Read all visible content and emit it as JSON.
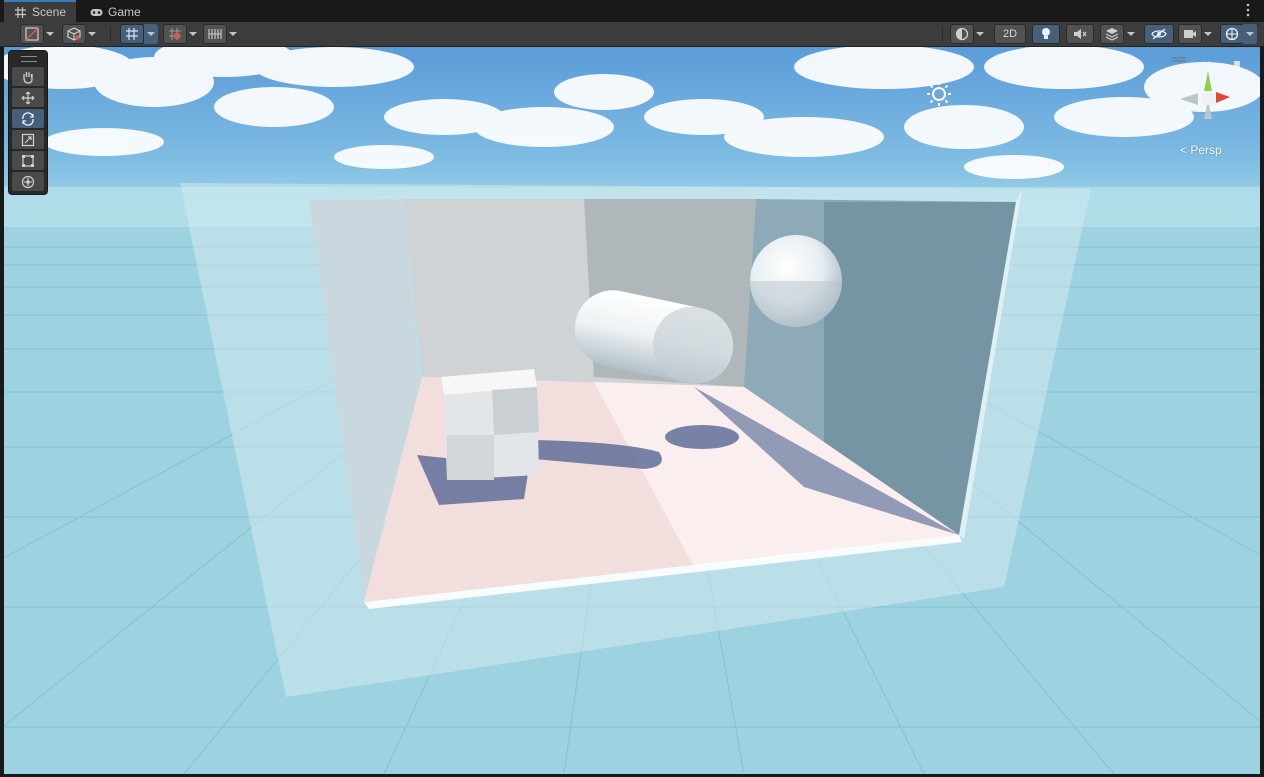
{
  "tabs": [
    {
      "label": "Scene",
      "icon": "grid-hash-icon",
      "active": true
    },
    {
      "label": "Game",
      "icon": "gamepad-icon",
      "active": false
    }
  ],
  "toolbar": {
    "left_buttons": [
      "draw-mode-icon",
      "render-mode-cube-icon",
      "grid-snap-icon",
      "incremental-snap-icon",
      "grid-visibility-icon"
    ],
    "mode_2d_label": "2D",
    "right_buttons": [
      "shading-mode-icon",
      "lighting-bulb-icon",
      "audio-mute-icon",
      "effects-layers-icon",
      "scene-visibility-icon",
      "camera-icon",
      "gizmos-icon"
    ]
  },
  "tools": [
    "hand-tool-icon",
    "move-tool-icon",
    "rotate-tool-icon",
    "scale-tool-icon",
    "rect-tool-icon",
    "transform-tool-icon"
  ],
  "active_tool": "rotate-tool-icon",
  "scene": {
    "view_mode": "Persp",
    "gizmo_axis_label": "y",
    "colors": {
      "sky_top": "#5b9bd8",
      "sky_horizon": "#b7e2ee",
      "ground": "#9dd3e0",
      "accent_active": "#46607c"
    }
  }
}
